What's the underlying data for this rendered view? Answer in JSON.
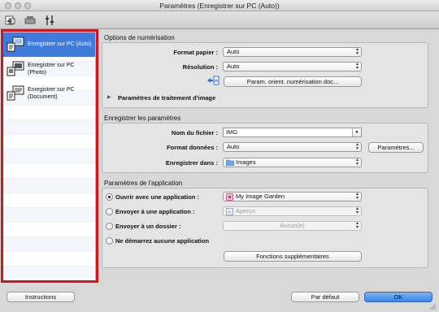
{
  "window": {
    "title": "Paramètres (Enregistrer sur PC (Auto))"
  },
  "toolbar": {
    "icons": [
      "scan-from-computer-icon",
      "scan-from-panel-icon",
      "general-settings-icon"
    ]
  },
  "sidebar": {
    "items": [
      {
        "label": "Enregistrer sur PC (Auto)",
        "selected": true,
        "icon": "save-auto-icon"
      },
      {
        "label": "Enregistrer sur PC (Photo)",
        "selected": false,
        "icon": "save-photo-icon"
      },
      {
        "label": "Enregistrer sur PC (Document)",
        "selected": false,
        "icon": "save-document-icon"
      }
    ]
  },
  "scan_options": {
    "title": "Options de numérisation",
    "paper_size_label": "Format papier :",
    "paper_size_value": "Auto",
    "resolution_label": "Résolution :",
    "resolution_value": "Auto",
    "orientation_button": "Param. orient. numérisation doc...",
    "image_processing_label": "Paramètres de traitement d'image"
  },
  "save_settings": {
    "title": "Enregistrer les paramètres",
    "filename_label": "Nom du fichier :",
    "filename_value": "IMG",
    "format_label": "Format données :",
    "format_value": "Auto",
    "format_settings_button": "Paramètres...",
    "save_in_label": "Enregistrer dans :",
    "save_in_value": "Images"
  },
  "app_settings": {
    "title": "Paramètres de l'application",
    "options": [
      {
        "label": "Ouvrir avec une application :",
        "checked": true,
        "value": "My Image Garden",
        "enabled": true
      },
      {
        "label": "Envoyer à une application :",
        "checked": false,
        "value": "Aperçu",
        "enabled": false
      },
      {
        "label": "Envoyer à un dossier :",
        "checked": false,
        "value": "Aucun(e)",
        "enabled": false
      },
      {
        "label": "Ne démarrez aucune application",
        "checked": false
      }
    ],
    "more_functions_button": "Fonctions supplémentaires"
  },
  "footer": {
    "instructions_button": "Instructions",
    "defaults_button": "Par défaut",
    "ok_button": "OK"
  },
  "colors": {
    "selection": "#3f7bd9",
    "highlight_frame": "#d3141a",
    "primary_button": "#3b86e6"
  }
}
